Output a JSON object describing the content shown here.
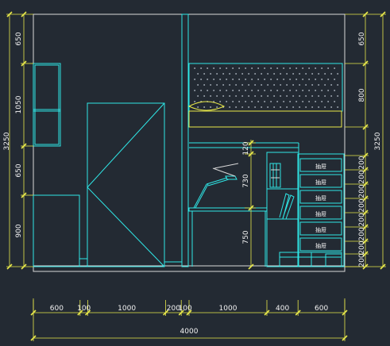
{
  "colors": {
    "background": "#232a33",
    "furniture": "#2fe6e6",
    "dimension": "#e8e84a",
    "wall": "#d9d9d9",
    "drawer_label": "#ffffff"
  },
  "left_dims": {
    "total": "3250",
    "segments": [
      "650",
      "1050",
      "650",
      "900"
    ]
  },
  "right_dims": {
    "total": "3250",
    "upper": [
      "650",
      "800"
    ],
    "drawers": [
      "200",
      "200",
      "200",
      "200",
      "200",
      "200",
      "200",
      "200"
    ]
  },
  "inner_dims": [
    "120",
    "730",
    "750"
  ],
  "bottom_dims": {
    "segments": [
      "600",
      "100",
      "1000",
      "200",
      "100",
      "1000",
      "400",
      "600"
    ],
    "total": "4000"
  },
  "drawer_labels": [
    "抽屉",
    "抽屉",
    "抽屉",
    "抽屉",
    "抽屉",
    "抽屉"
  ]
}
